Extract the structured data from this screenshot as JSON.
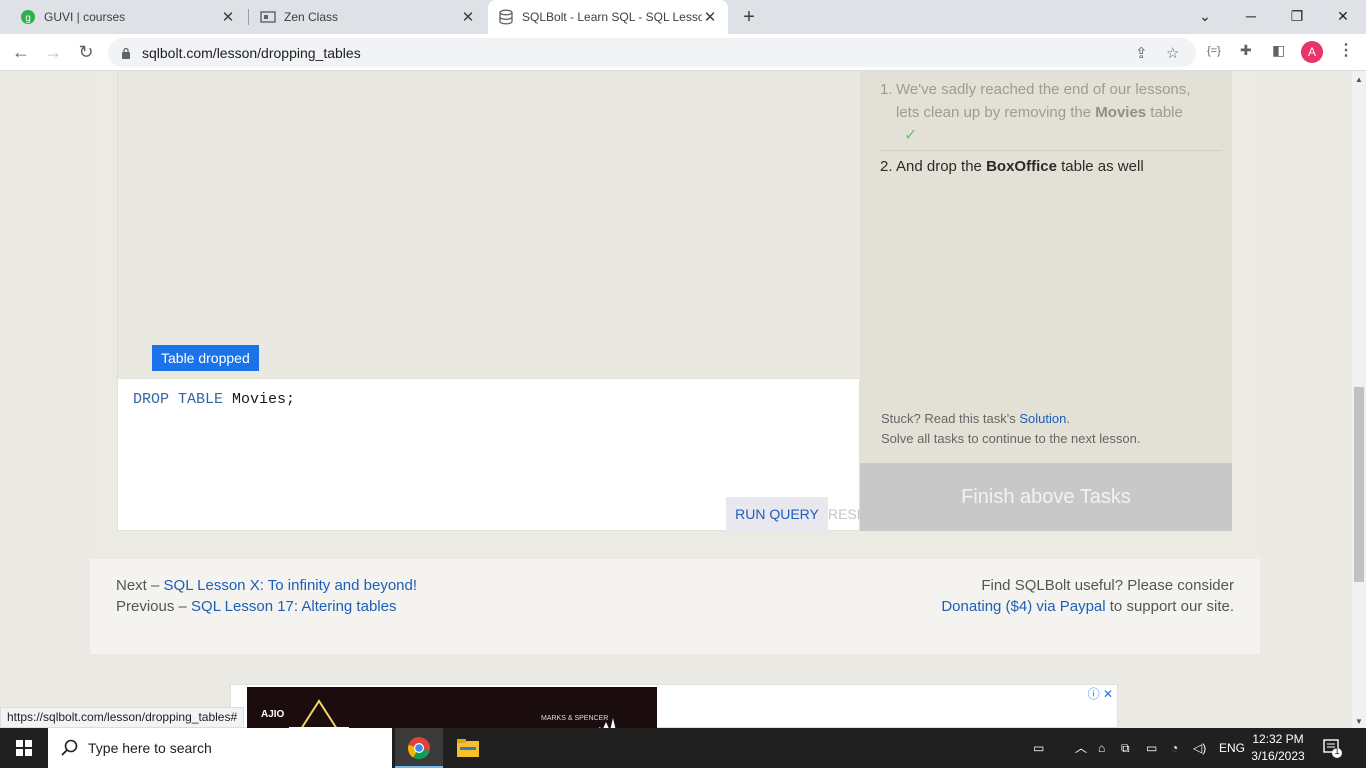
{
  "browser": {
    "tabs": [
      {
        "title": "GUVI | courses",
        "favicon": "guvi-icon"
      },
      {
        "title": "Zen Class",
        "favicon": "zen-icon"
      },
      {
        "title": "SQLBolt - Learn SQL - SQL Lesson",
        "favicon": "database-icon",
        "active": true
      }
    ],
    "url": "sqlbolt.com/lesson/dropping_tables",
    "profile_initial": "A"
  },
  "results": {
    "status": "Table dropped"
  },
  "editor": {
    "keyword": "DROP TABLE",
    "rest": " Movies;",
    "run_label": "RUN QUERY",
    "reset_label": "RESET"
  },
  "tasks": {
    "items": [
      {
        "number": "1.",
        "pre": "We've sadly reached the end of our lessons, lets clean up by removing the ",
        "bold": "Movies",
        "post": " table",
        "done": true,
        "check": "✓"
      },
      {
        "number": "2.",
        "pre": "And drop the ",
        "bold": "BoxOffice",
        "post": " table as well",
        "done": false
      }
    ],
    "stuck_text": "Stuck? Read this task's ",
    "solution_link": "Solution",
    "stuck_end": ".",
    "solve_text": "Solve all tasks to continue to the next lesson.",
    "finish_label": "Finish above Tasks"
  },
  "footer": {
    "next_prefix": "Next – ",
    "next_link": "SQL Lesson X: To infinity and beyond!",
    "prev_prefix": "Previous – ",
    "prev_link": "SQL Lesson 17: Altering tables",
    "useful_text": "Find SQLBolt useful? Please consider",
    "donate_link": "Donating ($4) via Paypal",
    "donate_suffix": " to support our site."
  },
  "ad": {
    "brand": "AJIO",
    "partner": "MARKS & SPENCER"
  },
  "status_url": "https://sqlbolt.com/lesson/dropping_tables#",
  "taskbar": {
    "search_placeholder": "Type here to search",
    "language": "ENG",
    "time": "12:32 PM",
    "date": "3/16/2023",
    "notification_count": "1"
  }
}
